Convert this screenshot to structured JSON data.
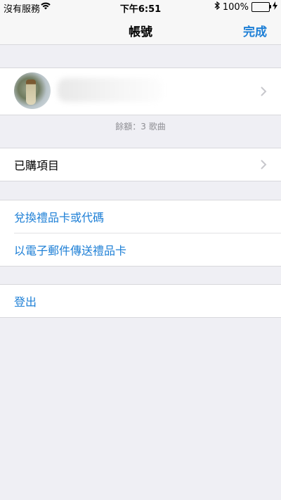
{
  "status_bar": {
    "carrier": "沒有服務",
    "time": "下午6:51",
    "battery_percent": "100%",
    "battery_level": 1.0,
    "icons": [
      "wifi-icon",
      "bluetooth-icon",
      "battery-icon",
      "charging-icon"
    ]
  },
  "nav": {
    "title": "帳號",
    "done_label": "完成"
  },
  "account": {
    "balance_text": "餘額：3 歌曲"
  },
  "purchased": {
    "label": "已購項目"
  },
  "gift": {
    "redeem_label": "兌換禮品卡或代碼",
    "send_label": "以電子郵件傳送禮品卡"
  },
  "session": {
    "sign_out_label": "登出"
  },
  "colors": {
    "accent": "#1d7fd6",
    "background": "#efeff4",
    "battery": "#4cd964"
  }
}
